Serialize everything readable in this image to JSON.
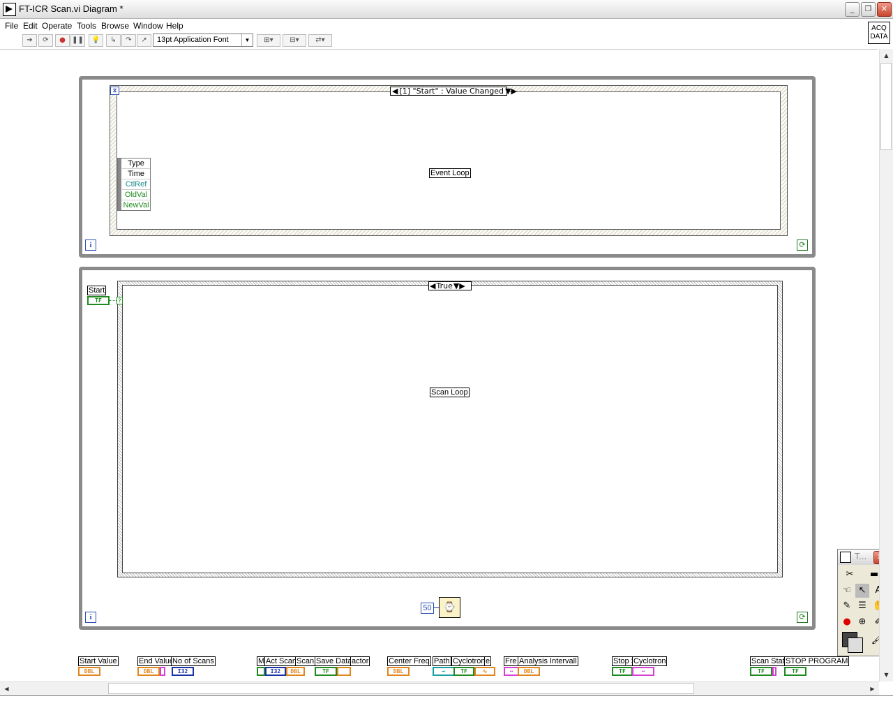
{
  "window": {
    "title": "FT-ICR Scan.vi Diagram *",
    "minimize": "_",
    "restore": "❐",
    "close": "✕"
  },
  "menu": [
    "File",
    "Edit",
    "Operate",
    "Tools",
    "Browse",
    "Window",
    "Help"
  ],
  "vi_icon": {
    "line1": "ACQ",
    "line2": "DATA"
  },
  "toolbar": {
    "font": "13pt Application Font"
  },
  "event_loop": {
    "selector": "[1] \"Start\" : Value Changed",
    "label": "Event Loop",
    "data_node": [
      "Type",
      "Time",
      "CtlRef",
      "OldVal",
      "NewVal"
    ],
    "iteration": "i"
  },
  "scan_loop": {
    "selector": "True",
    "label": "Scan Loop",
    "start_label": "Start",
    "start_terminal": "TF",
    "wait_constant": "50",
    "iteration": "i"
  },
  "bottom_terminals": [
    {
      "label": "Start Value",
      "type": "DBL"
    },
    {
      "label": "End Value",
      "type": "DBL"
    },
    {
      "label": "No of Scans",
      "type": "I32"
    },
    {
      "label": "M",
      "type": "TF"
    },
    {
      "label": "Act Scan",
      "type": "I32"
    },
    {
      "label": "Scan",
      "type": "DBL"
    },
    {
      "label": "Save Data",
      "type": "TF"
    },
    {
      "label": "actor",
      "type": "DBL"
    },
    {
      "label": "Center Freq",
      "type": "DBL"
    },
    {
      "label": "Path",
      "type": "PATH"
    },
    {
      "label": "Cyclotron",
      "type": "TF"
    },
    {
      "label": "e",
      "type": "WAVE"
    },
    {
      "label": "Fre",
      "type": "REF"
    },
    {
      "label": "Analysis Intervall",
      "type": "DBL"
    },
    {
      "label": "Stop S",
      "type": "TF"
    },
    {
      "label": "Cyclotron",
      "type": "REF"
    },
    {
      "label": "Scan Stat",
      "type": "TF"
    },
    {
      "label": "STOP PROGRAM",
      "type": "TF"
    }
  ],
  "tools_palette": {
    "title": "T..."
  }
}
